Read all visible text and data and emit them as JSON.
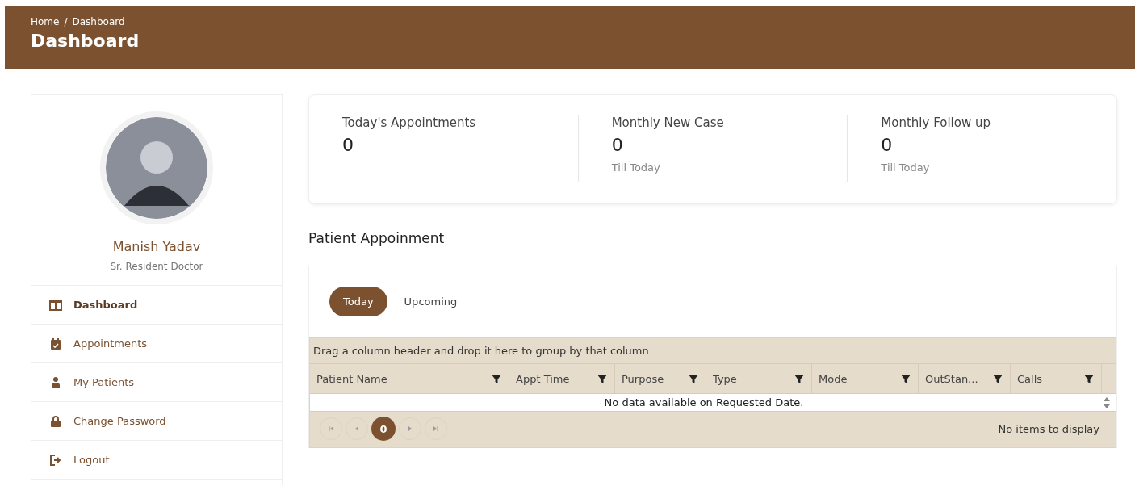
{
  "header": {
    "breadcrumb": [
      {
        "label": "Home"
      },
      {
        "label": "Dashboard"
      }
    ],
    "separator": "/",
    "title": "Dashboard"
  },
  "profile": {
    "name": "Manish Yadav",
    "role": "Sr. Resident Doctor"
  },
  "sidebar": {
    "items": [
      {
        "label": "Dashboard",
        "kind": "layout",
        "selected": true
      },
      {
        "label": "Appointments",
        "kind": "calendar",
        "selected": false
      },
      {
        "label": "My Patients",
        "kind": "patient",
        "selected": false
      },
      {
        "label": "Change Password",
        "kind": "lock",
        "selected": false
      },
      {
        "label": "Logout",
        "kind": "logout",
        "selected": false
      }
    ]
  },
  "stats": [
    {
      "label": "Today's Appointments",
      "value": "0"
    },
    {
      "label": "Monthly New Case",
      "value": "0",
      "note": "Till Today"
    },
    {
      "label": "Monthly Follow up",
      "value": "0",
      "note": "Till Today"
    }
  ],
  "section_title": "Patient Appoinment",
  "tabs": [
    {
      "label": "Today",
      "selected": true
    },
    {
      "label": "Upcoming",
      "selected": false
    }
  ],
  "grid": {
    "group_hint": "Drag a column header and drop it here to group by that column",
    "columns": [
      "Patient Name",
      "Appt Time",
      "Purpose",
      "Type",
      "Mode",
      "OutStan...",
      "Calls"
    ],
    "empty_message": "No data available on Requested Date.",
    "pager": {
      "page": "0",
      "info": "No items to display"
    }
  }
}
